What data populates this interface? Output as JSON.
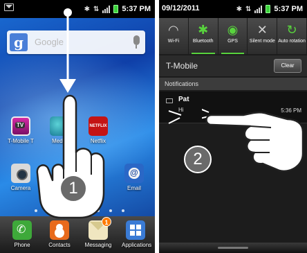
{
  "left": {
    "status_time": "5:37 PM",
    "search_placeholder": "Google",
    "search_logo": "g",
    "row1_apps": [
      {
        "label": "T-Mobile T",
        "icon": "tmobile-tv-icon"
      },
      {
        "label": "Media",
        "icon": "media-hub-icon"
      },
      {
        "label": "Netflix",
        "icon": "netflix-icon",
        "icon_text": "NETFLIX"
      }
    ],
    "row2_apps": [
      {
        "label": "Camera",
        "icon": "camera-icon"
      },
      {
        "label": "Email",
        "icon": "email-icon"
      }
    ],
    "dock": [
      {
        "label": "Phone",
        "icon": "phone-icon"
      },
      {
        "label": "Contacts",
        "icon": "contacts-icon"
      },
      {
        "label": "Messaging",
        "icon": "messaging-icon",
        "badge": "1"
      },
      {
        "label": "Applications",
        "icon": "applications-icon"
      }
    ],
    "step_number": "1"
  },
  "right": {
    "date": "09/12/2011",
    "status_time": "5:37 PM",
    "toggles": [
      {
        "label": "Wi-Fi",
        "icon": "wifi-icon",
        "on": false
      },
      {
        "label": "Bluetooth",
        "icon": "bluetooth-icon",
        "on": true
      },
      {
        "label": "GPS",
        "icon": "gps-icon",
        "on": true
      },
      {
        "label": "Silent mode",
        "icon": "silent-mode-icon",
        "on": false
      },
      {
        "label": "Auto rotation",
        "icon": "auto-rotation-icon",
        "on": false
      }
    ],
    "carrier": "T-Mobile",
    "clear_label": "Clear",
    "notifications_header": "Notifications",
    "notification": {
      "title": "Pat",
      "body": "Hi",
      "time": "5:36 PM",
      "icon": "message-icon"
    },
    "step_number": "2"
  },
  "colors": {
    "toggle_on": "#58d33d",
    "status_bar": "#000000",
    "wallpaper": "#1b6fd6"
  }
}
